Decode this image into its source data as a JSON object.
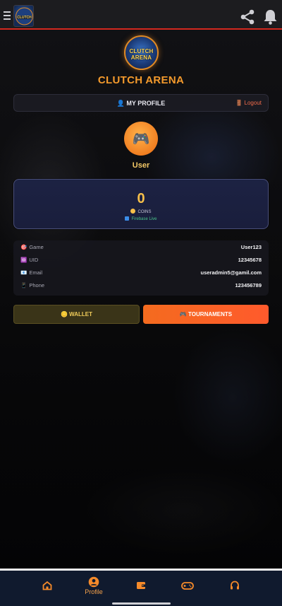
{
  "header": {
    "menu_icon": "hamburger-icon",
    "logo_icon": "clutch-arena-logo",
    "share_icon": "share-icon",
    "bell_icon": "bell-icon"
  },
  "brand": {
    "title": "CLUTCH ARENA",
    "logo_text": "CLUTCH ARENA"
  },
  "profile_bar": {
    "title": "👤 MY PROFILE",
    "logout_label": "🚪 Logout"
  },
  "user": {
    "avatar_icon": "🎮",
    "name": "User"
  },
  "coins": {
    "value": "0",
    "label": "COINS",
    "status": "Firebase Live"
  },
  "info": [
    {
      "icon": "🎯",
      "key": "Game",
      "value": "User123"
    },
    {
      "icon": "🆔",
      "key": "UID",
      "value": "12345678"
    },
    {
      "icon": "📧",
      "key": "Email",
      "value": "useradmin5@gamil.com"
    },
    {
      "icon": "📱",
      "key": "Phone",
      "value": "123456789"
    }
  ],
  "buttons": {
    "wallet": "🪙 WALLET",
    "tournaments": "🎮 TOURNAMENTS"
  },
  "nav": {
    "active": "Profile",
    "items": [
      "home-icon",
      "profile-icon",
      "wallet-icon",
      "gamepad-icon",
      "headset-icon"
    ],
    "profile_label": "Profile"
  },
  "colors": {
    "accent": "#f49a2c",
    "header_border": "#d4281f",
    "tournaments": "#f46b1f",
    "nav_bg": "#101a2e"
  }
}
